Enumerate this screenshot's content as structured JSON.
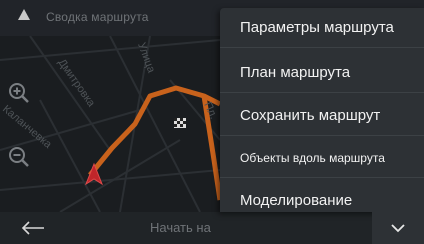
{
  "header": {
    "title": "Сводка маршрута",
    "arrow_icon": "triangle-up-icon"
  },
  "map": {
    "streets": [
      "Дмитровка",
      "Улица",
      "Каланчевка",
      "Пл."
    ],
    "route_color": "#c8621c",
    "map_bg": "#1a1d20"
  },
  "controls": {
    "zoom_in_icon": "zoom-in-icon",
    "zoom_out_icon": "zoom-out-icon"
  },
  "bottom": {
    "back_icon": "back-arrow-icon",
    "start_label": "Начать на"
  },
  "menu": {
    "items": [
      {
        "label": "Параметры маршрута"
      },
      {
        "label": "План маршрута"
      },
      {
        "label": "Сохранить маршрут"
      },
      {
        "label": "Объекты вдоль маршрута"
      },
      {
        "label": "Моделирование"
      }
    ],
    "collapse_icon": "chevron-down-icon"
  }
}
